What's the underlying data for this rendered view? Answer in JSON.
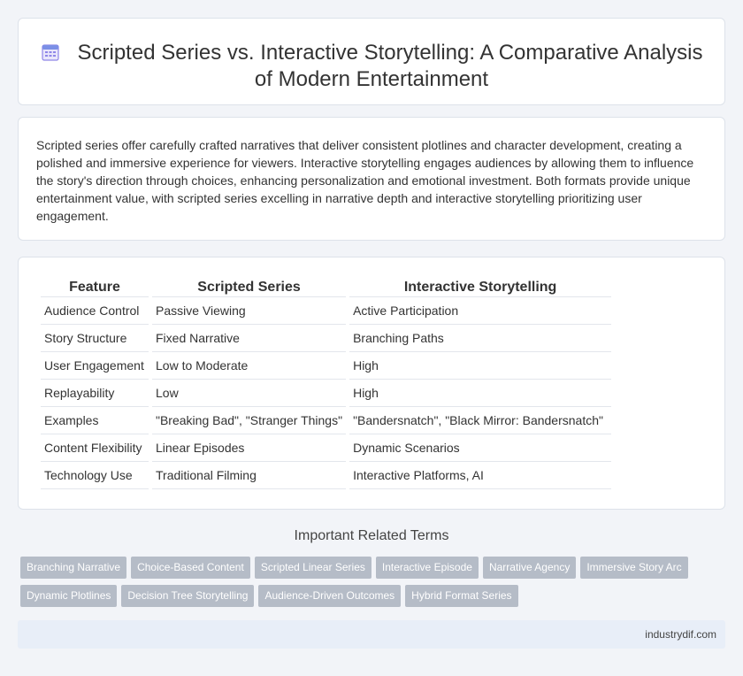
{
  "header": {
    "icon": "calendar-icon",
    "title": "Scripted Series vs. Interactive Storytelling: A Comparative Analysis of Modern Entertainment"
  },
  "intro": {
    "text": "Scripted series offer carefully crafted narratives that deliver consistent plotlines and character development, creating a polished and immersive experience for viewers. Interactive storytelling engages audiences by allowing them to influence the story's direction through choices, enhancing personalization and emotional investment. Both formats provide unique entertainment value, with scripted series excelling in narrative depth and interactive storytelling prioritizing user engagement."
  },
  "comparison": {
    "headers": [
      "Feature",
      "Scripted Series",
      "Interactive Storytelling"
    ],
    "rows": [
      [
        "Audience Control",
        "Passive Viewing",
        "Active Participation"
      ],
      [
        "Story Structure",
        "Fixed Narrative",
        "Branching Paths"
      ],
      [
        "User Engagement",
        "Low to Moderate",
        "High"
      ],
      [
        "Replayability",
        "Low",
        "High"
      ],
      [
        "Examples",
        "\"Breaking Bad\", \"Stranger Things\"",
        "\"Bandersnatch\", \"Black Mirror: Bandersnatch\""
      ],
      [
        "Content Flexibility",
        "Linear Episodes",
        "Dynamic Scenarios"
      ],
      [
        "Technology Use",
        "Traditional Filming",
        "Interactive Platforms, AI"
      ]
    ]
  },
  "related": {
    "heading": "Important Related Terms",
    "tags_row1": [
      "Branching Narrative",
      "Choice-Based Content",
      "Scripted Linear Series",
      "Interactive Episode",
      "Narrative Agency",
      "Immersive Story Arc"
    ],
    "tags_row2": [
      "Dynamic Plotlines",
      "Decision Tree Storytelling",
      "Audience-Driven Outcomes",
      "Hybrid Format Series"
    ]
  },
  "footer": {
    "site": "industrydif.com"
  }
}
